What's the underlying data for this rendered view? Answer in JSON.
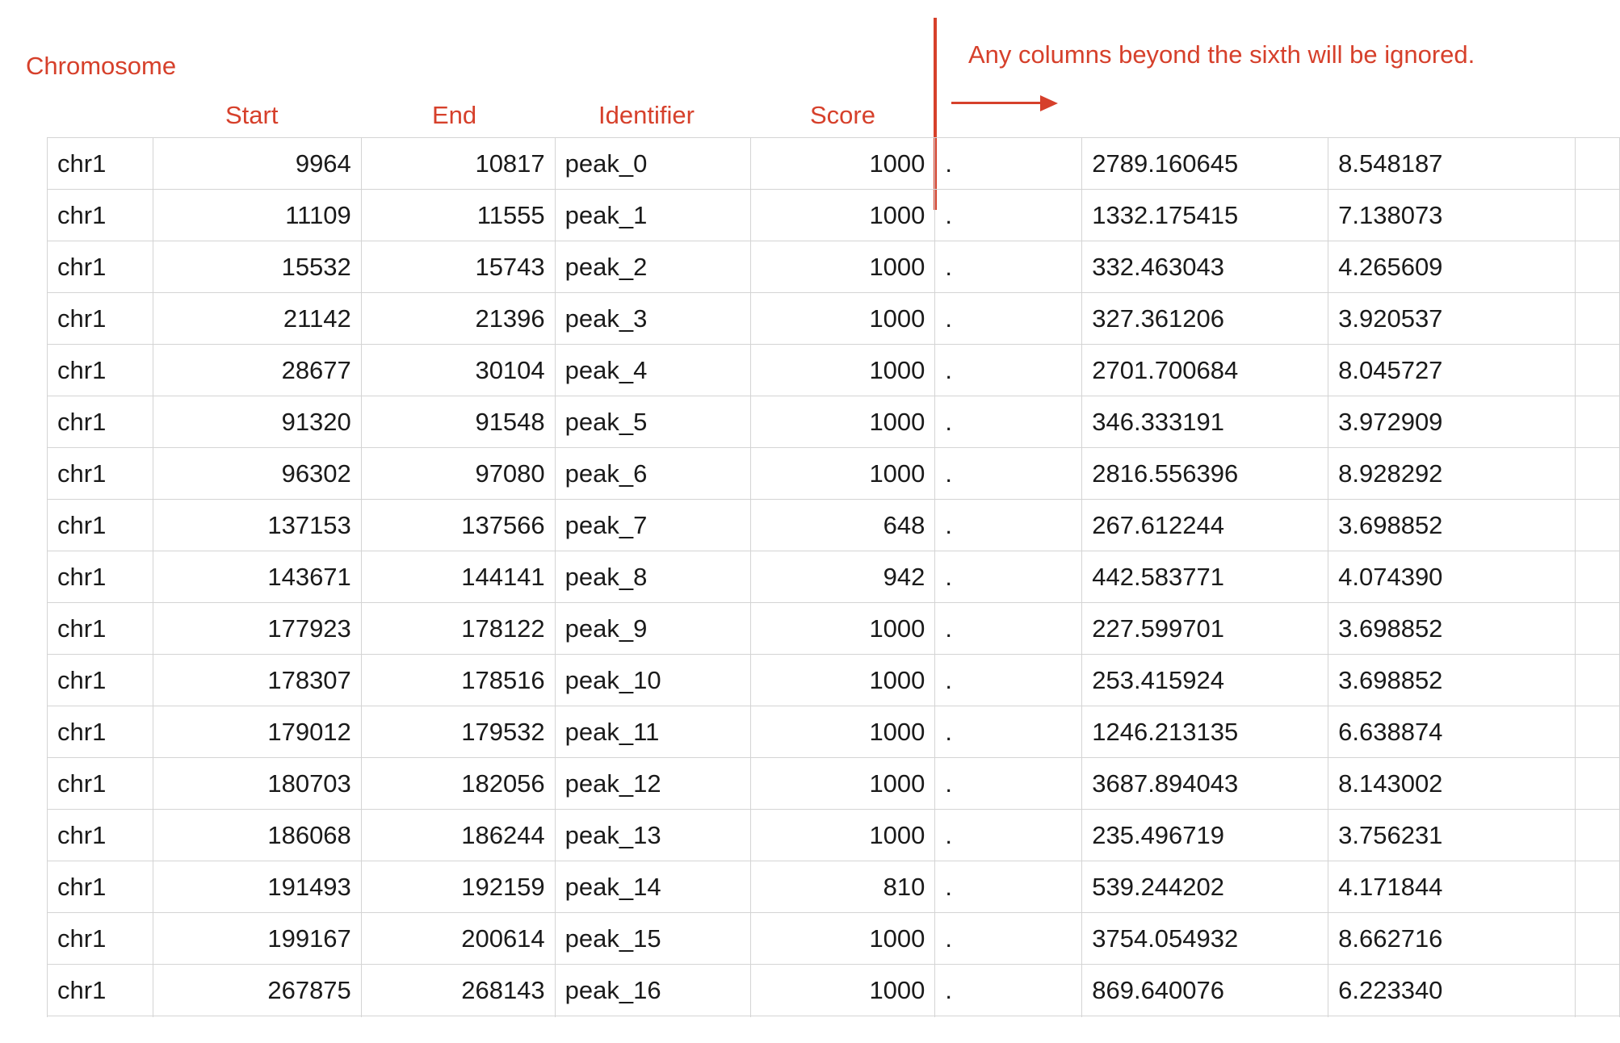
{
  "annotations": {
    "chromosome": "Chromosome",
    "start": "Start",
    "end": "End",
    "identifier": "Identifier",
    "score": "Score",
    "note": "Any columns beyond the sixth will be ignored."
  },
  "colors": {
    "annotation": "#d6402b",
    "grid_line": "#d4d4d4",
    "cell_text": "#1a1a1a"
  },
  "rows": [
    {
      "chrom": "chr1",
      "start": "9964",
      "end": "10817",
      "id": "peak_0",
      "score": "1000",
      "strand": ".",
      "signal": "2789.160645",
      "pvalue": "8.548187"
    },
    {
      "chrom": "chr1",
      "start": "11109",
      "end": "11555",
      "id": "peak_1",
      "score": "1000",
      "strand": ".",
      "signal": "1332.175415",
      "pvalue": "7.138073"
    },
    {
      "chrom": "chr1",
      "start": "15532",
      "end": "15743",
      "id": "peak_2",
      "score": "1000",
      "strand": ".",
      "signal": "332.463043",
      "pvalue": "4.265609"
    },
    {
      "chrom": "chr1",
      "start": "21142",
      "end": "21396",
      "id": "peak_3",
      "score": "1000",
      "strand": ".",
      "signal": "327.361206",
      "pvalue": "3.920537"
    },
    {
      "chrom": "chr1",
      "start": "28677",
      "end": "30104",
      "id": "peak_4",
      "score": "1000",
      "strand": ".",
      "signal": "2701.700684",
      "pvalue": "8.045727"
    },
    {
      "chrom": "chr1",
      "start": "91320",
      "end": "91548",
      "id": "peak_5",
      "score": "1000",
      "strand": ".",
      "signal": "346.333191",
      "pvalue": "3.972909"
    },
    {
      "chrom": "chr1",
      "start": "96302",
      "end": "97080",
      "id": "peak_6",
      "score": "1000",
      "strand": ".",
      "signal": "2816.556396",
      "pvalue": "8.928292"
    },
    {
      "chrom": "chr1",
      "start": "137153",
      "end": "137566",
      "id": "peak_7",
      "score": "648",
      "strand": ".",
      "signal": "267.612244",
      "pvalue": "3.698852"
    },
    {
      "chrom": "chr1",
      "start": "143671",
      "end": "144141",
      "id": "peak_8",
      "score": "942",
      "strand": ".",
      "signal": "442.583771",
      "pvalue": "4.074390"
    },
    {
      "chrom": "chr1",
      "start": "177923",
      "end": "178122",
      "id": "peak_9",
      "score": "1000",
      "strand": ".",
      "signal": "227.599701",
      "pvalue": "3.698852"
    },
    {
      "chrom": "chr1",
      "start": "178307",
      "end": "178516",
      "id": "peak_10",
      "score": "1000",
      "strand": ".",
      "signal": "253.415924",
      "pvalue": "3.698852"
    },
    {
      "chrom": "chr1",
      "start": "179012",
      "end": "179532",
      "id": "peak_11",
      "score": "1000",
      "strand": ".",
      "signal": "1246.213135",
      "pvalue": "6.638874"
    },
    {
      "chrom": "chr1",
      "start": "180703",
      "end": "182056",
      "id": "peak_12",
      "score": "1000",
      "strand": ".",
      "signal": "3687.894043",
      "pvalue": "8.143002"
    },
    {
      "chrom": "chr1",
      "start": "186068",
      "end": "186244",
      "id": "peak_13",
      "score": "1000",
      "strand": ".",
      "signal": "235.496719",
      "pvalue": "3.756231"
    },
    {
      "chrom": "chr1",
      "start": "191493",
      "end": "192159",
      "id": "peak_14",
      "score": "810",
      "strand": ".",
      "signal": "539.244202",
      "pvalue": "4.171844"
    },
    {
      "chrom": "chr1",
      "start": "199167",
      "end": "200614",
      "id": "peak_15",
      "score": "1000",
      "strand": ".",
      "signal": "3754.054932",
      "pvalue": "8.662716"
    },
    {
      "chrom": "chr1",
      "start": "267875",
      "end": "268143",
      "id": "peak_16",
      "score": "1000",
      "strand": ".",
      "signal": "869.640076",
      "pvalue": "6.223340"
    }
  ]
}
